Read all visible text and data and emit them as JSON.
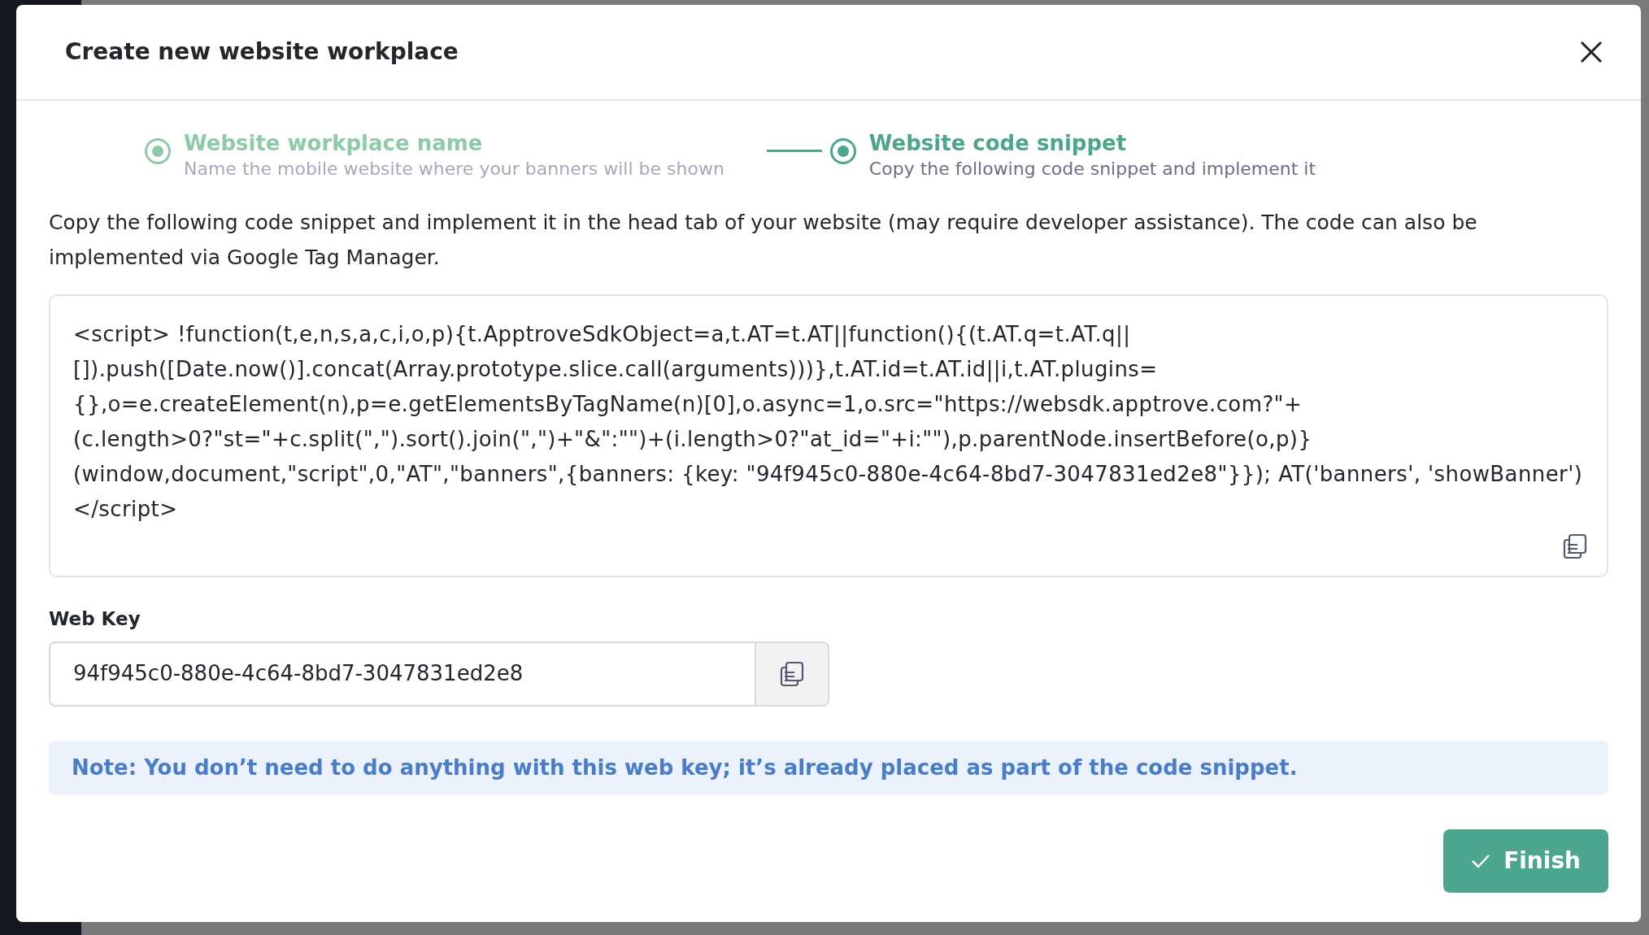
{
  "dialog": {
    "title": "Create new website workplace"
  },
  "steps": [
    {
      "title": "Website workplace name",
      "subtitle": "Name the mobile website where your banners will be shown",
      "selected": false
    },
    {
      "title": "Website code snippet",
      "subtitle": "Copy the following code snippet and implement it",
      "selected": true
    }
  ],
  "instructions": "Copy the following code snippet and implement it in the head tab of your website (may require developer assistance). The code can also be implemented via Google Tag Manager.",
  "code_snippet": "<script> !function(t,e,n,s,a,c,i,o,p){t.ApptroveSdkObject=a,t.AT=t.AT||function(){(t.AT.q=t.AT.q|| []).push([Date.now()].concat(Array.prototype.slice.call(arguments)))},t.AT.id=t.AT.id||i,t.AT.plugins= {},o=e.createElement(n),p=e.getElementsByTagName(n)[0],o.async=1,o.src=\"https://websdk.apptrove.com?\"+ (c.length>0?\"st=\"+c.split(\",\").sort().join(\",\")+\"&\":\"\")+(i.length>0?\"at_id=\"+i:\"\"),p.parentNode.insertBefore(o,p)} (window,document,\"script\",0,\"AT\",\"banners\",{banners: {key: \"94f945c0-880e-4c64-8bd7-3047831ed2e8\"}}); AT('banners', 'showBanner') </script>",
  "web_key": {
    "label": "Web Key",
    "value": "94f945c0-880e-4c64-8bd7-3047831ed2e8"
  },
  "note": "Note: You don’t need to do anything with this web key; it’s already placed as part of the code snippet.",
  "buttons": [
    {
      "label": "Finish"
    }
  ]
}
